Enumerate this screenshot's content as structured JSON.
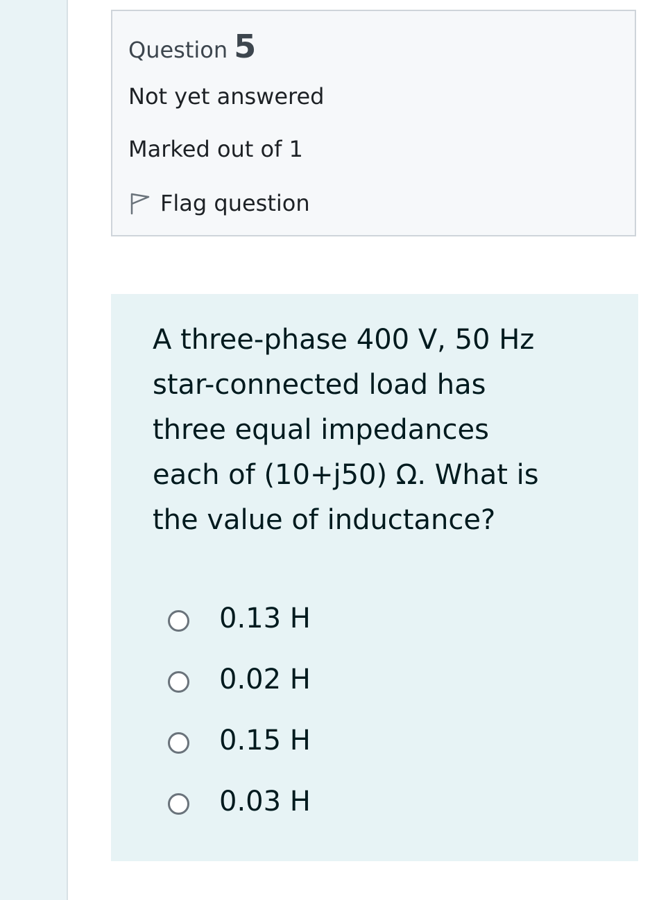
{
  "question_info": {
    "label": "Question",
    "number": "5",
    "state": "Not yet answered",
    "grade": "Marked out of 1",
    "flag_label": "Flag question",
    "flag_icon": "flag-icon"
  },
  "question": {
    "text": "A three-phase 400 V, 50 Hz\nstar-connected load has\nthree equal impedances\neach of (10+j50) Ω. What is\nthe value of inductance?",
    "answers": [
      {
        "label": "0.13 H",
        "selected": false
      },
      {
        "label": "0.02 H",
        "selected": false
      },
      {
        "label": "0.15 H",
        "selected": false
      },
      {
        "label": "0.03 H",
        "selected": false
      }
    ]
  },
  "colors": {
    "rail_background": "#e9f3f6",
    "info_background": "#f6f8fa",
    "info_border": "#ced4da",
    "question_background": "#e7f3f5",
    "text": "#1d2125",
    "radio_border": "#6a737b"
  }
}
